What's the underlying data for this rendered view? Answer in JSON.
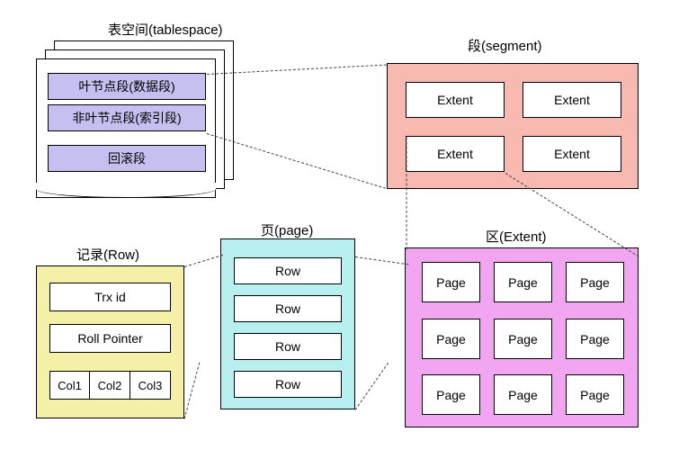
{
  "tablespace": {
    "title": "表空间(tablespace)",
    "segments": [
      "叶节点段(数据段)",
      "非叶节点段(索引段)",
      "回滚段"
    ]
  },
  "segment": {
    "title": "段(segment)",
    "cells": [
      "Extent",
      "Extent",
      "Extent",
      "Extent"
    ]
  },
  "extent": {
    "title": "区(Extent)",
    "cells": [
      "Page",
      "Page",
      "Page",
      "Page",
      "Page",
      "Page",
      "Page",
      "Page",
      "Page"
    ]
  },
  "page": {
    "title": "页(page)",
    "rows": [
      "Row",
      "Row",
      "Row",
      "Row"
    ]
  },
  "row": {
    "title": "记录(Row)",
    "trx": "Trx id",
    "rollptr": "Roll Pointer",
    "cols": [
      "Col1",
      "Col2",
      "Col3"
    ]
  }
}
